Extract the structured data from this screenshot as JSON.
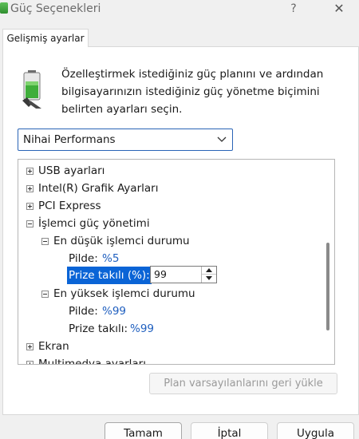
{
  "window": {
    "title": "Güç Seçenekleri",
    "help_label": "?",
    "close_label": "✕"
  },
  "tabs": [
    {
      "label": "Gelişmiş ayarlar"
    }
  ],
  "intro": {
    "line1": "Özelleştirmek istediğiniz güç planını ve ardından",
    "line2": "bilgisayarınızın istediğiniz güç yönetme biçimini",
    "line3": "belirten ayarları seçin."
  },
  "plan_select": {
    "value": "Nihai Performans"
  },
  "tree": {
    "usb": "USB ayarları",
    "intel": "Intel(R) Grafik Ayarları",
    "pci": "PCI Express",
    "cpu": "İşlemci güç yönetimi",
    "min_state": "En düşük işlemci durumu",
    "min_battery_label": "Pilde:",
    "min_battery_value": "%5",
    "min_plugged_label": "Prize takılı (%):",
    "min_plugged_value": "99",
    "max_state": "En yüksek işlemci durumu",
    "max_battery_label": "Pilde:",
    "max_battery_value": "%99",
    "max_plugged_label": "Prize takılı:",
    "max_plugged_value": "%99",
    "display": "Ekran",
    "multimedia": "Multimedya ayarları"
  },
  "restore_button": "Plan varsayılanlarını geri yükle",
  "buttons": {
    "ok": "Tamam",
    "cancel": "İptal",
    "apply": "Uygula"
  },
  "icons": {
    "title": "power-options-icon",
    "battery": "battery-plug-icon",
    "chevron": "chevron-down-icon"
  },
  "colors": {
    "accent": "#0a64d6",
    "value_blue": "#1f5fbf"
  }
}
